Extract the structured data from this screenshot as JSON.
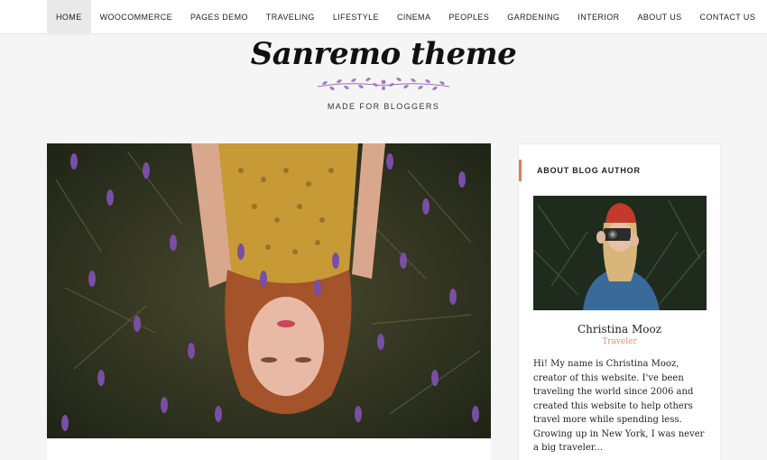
{
  "nav": {
    "items": [
      {
        "label": "HOME"
      },
      {
        "label": "WOOCOMMERCE"
      },
      {
        "label": "PAGES DEMO"
      },
      {
        "label": "TRAVELING"
      },
      {
        "label": "LIFESTYLE"
      },
      {
        "label": "CINEMA"
      },
      {
        "label": "PEOPLES"
      },
      {
        "label": "GARDENING"
      },
      {
        "label": "INTERIOR"
      },
      {
        "label": "ABOUT US"
      },
      {
        "label": "CONTACT US"
      }
    ],
    "active_index": 0
  },
  "header": {
    "logo_text": "Sanremo theme",
    "tagline": "MADE FOR BLOGGERS",
    "ornament_icon": "lavender-sprig-icon"
  },
  "hero": {
    "image_description_icon": "hero-photo"
  },
  "sidebar": {
    "widget_title": "ABOUT BLOG AUTHOR",
    "author_name": "Christina Mooz",
    "author_role": "Traveler",
    "author_bio": "Hi! My name is Christina Mooz, creator of this website. I've been traveling the world since 2006 and created this website to help others travel more while spending less. Growing up in New York, I was never a big traveler...",
    "accent_color": "#e07b5f"
  }
}
